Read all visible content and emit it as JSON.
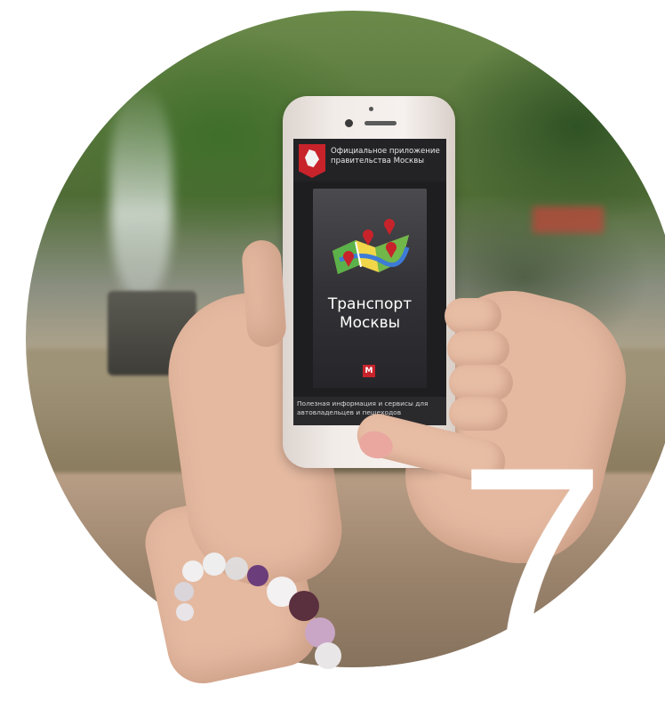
{
  "screen": {
    "header_text": "Официальное приложение правительства Москвы",
    "app_title_line1": "Транспорт",
    "app_title_line2": "Москвы",
    "footer_text": "Полезная информация и сервисы для автовладельцев и пешеходов"
  },
  "overlay": {
    "number": "7"
  },
  "colors": {
    "moscow_red": "#c8232b",
    "screen_bg": "#1e1e20",
    "map_yellow": "#f1d64a",
    "map_green": "#5bb24a",
    "map_blue": "#3d7bd6"
  },
  "icons": [
    "moscow-coat-of-arms-icon",
    "transport-map-icon",
    "moscow-logo-icon"
  ]
}
